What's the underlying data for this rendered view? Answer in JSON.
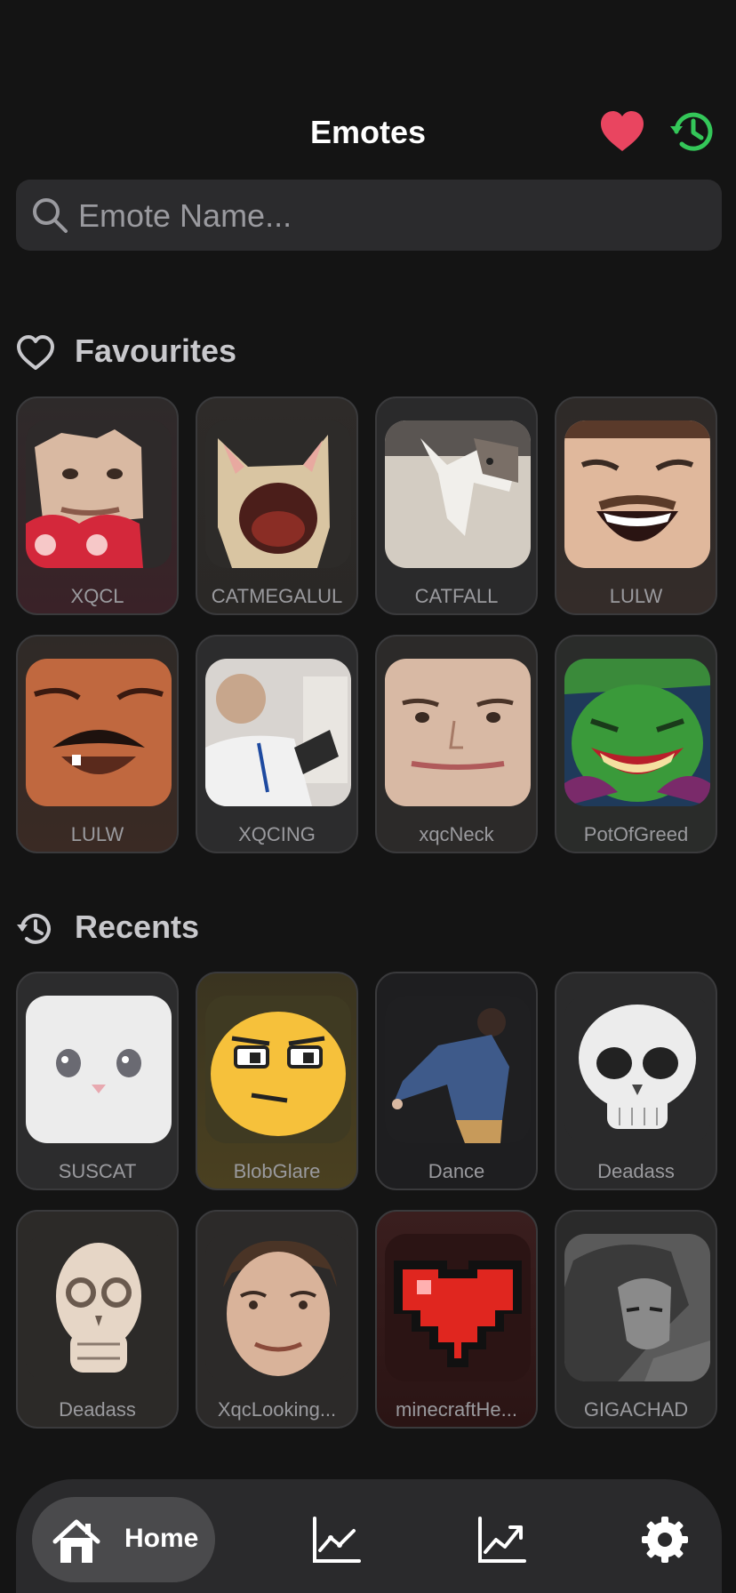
{
  "header": {
    "title": "Emotes",
    "favourites_icon": "heart-icon",
    "history_icon": "history-icon",
    "colors": {
      "favourite": "#e94560",
      "history": "#34c759"
    }
  },
  "search": {
    "placeholder": "Emote Name...",
    "value": "",
    "icon": "search-icon"
  },
  "favourites": {
    "label": "Favourites",
    "icon": "heart-outline-icon",
    "items": [
      {
        "name": "XQCL"
      },
      {
        "name": "CATMEGALUL"
      },
      {
        "name": "CATFALL"
      },
      {
        "name": "LULW"
      },
      {
        "name": "LULW"
      },
      {
        "name": "XQCING"
      },
      {
        "name": "xqcNeck"
      },
      {
        "name": "PotOfGreed"
      }
    ]
  },
  "recents": {
    "label": "Recents",
    "icon": "history-icon",
    "items": [
      {
        "name": "SUSCAT"
      },
      {
        "name": "BlobGlare"
      },
      {
        "name": "Dance"
      },
      {
        "name": "Deadass"
      },
      {
        "name": "Deadass"
      },
      {
        "name": "XqcLooking..."
      },
      {
        "name": "minecraftHe..."
      },
      {
        "name": "GIGACHAD"
      }
    ]
  },
  "tabbar": {
    "home_label": "Home",
    "tabs": [
      "home-icon",
      "chart-line-icon",
      "trending-up-icon",
      "gear-icon"
    ]
  }
}
